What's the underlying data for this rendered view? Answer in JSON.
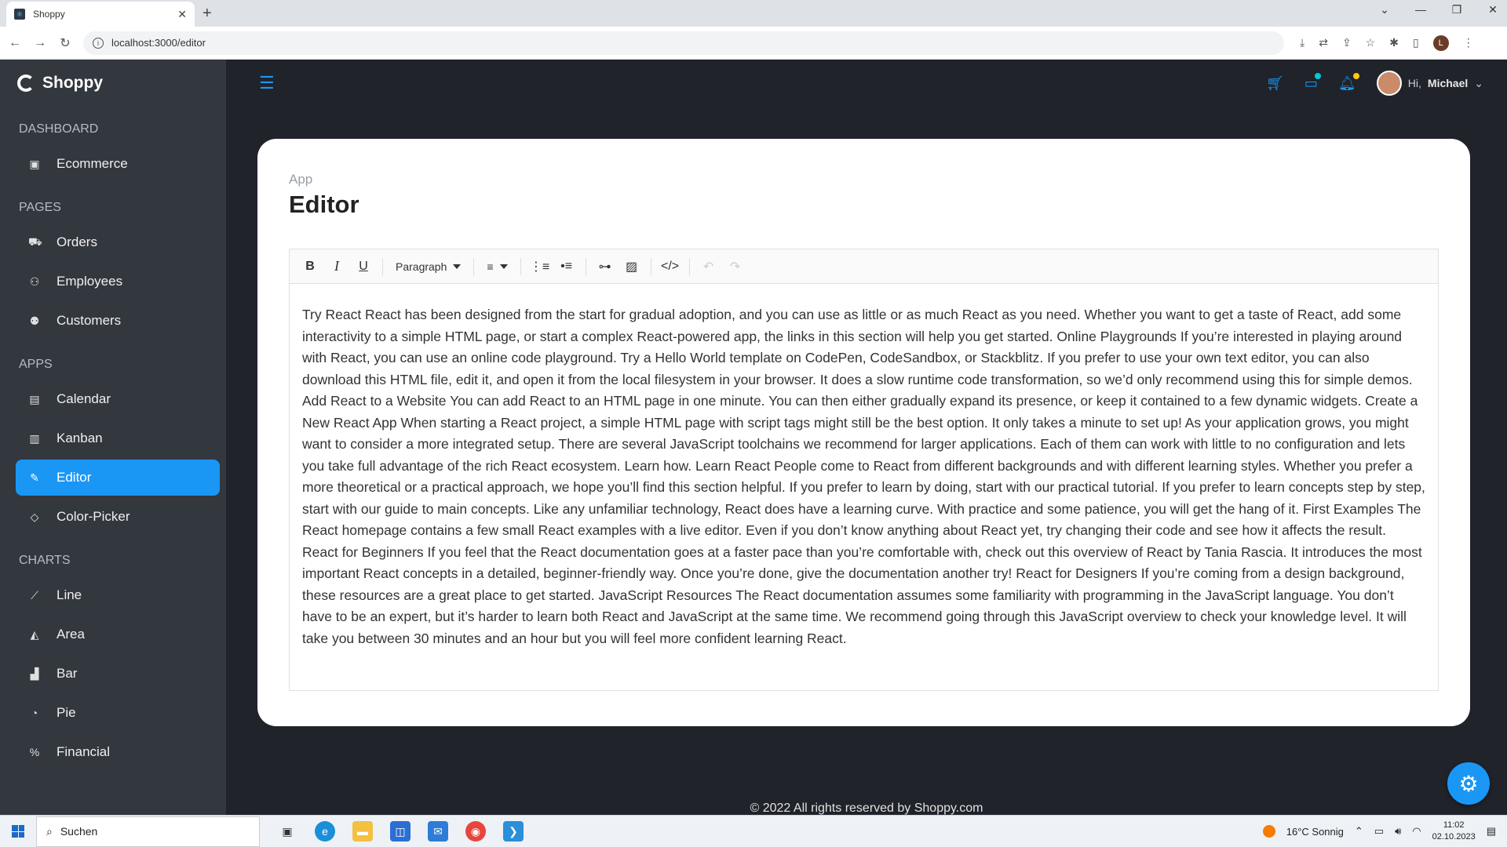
{
  "browser": {
    "tab_title": "Shoppy",
    "url": "localhost:3000/editor",
    "profile_initial": "L"
  },
  "brand": {
    "name": "Shoppy"
  },
  "sidebar": {
    "sections": [
      {
        "title": "DASHBOARD",
        "items": [
          {
            "label": "Ecommerce",
            "icon": "bag-icon"
          }
        ]
      },
      {
        "title": "PAGES",
        "items": [
          {
            "label": "Orders",
            "icon": "cart-icon"
          },
          {
            "label": "Employees",
            "icon": "people-icon"
          },
          {
            "label": "Customers",
            "icon": "customers-icon"
          }
        ]
      },
      {
        "title": "APPS",
        "items": [
          {
            "label": "Calendar",
            "icon": "calendar-icon"
          },
          {
            "label": "Kanban",
            "icon": "kanban-icon"
          },
          {
            "label": "Editor",
            "icon": "edit-icon",
            "active": true
          },
          {
            "label": "Color-Picker",
            "icon": "color-picker-icon"
          }
        ]
      },
      {
        "title": "CHARTS",
        "items": [
          {
            "label": "Line",
            "icon": "line-chart-icon"
          },
          {
            "label": "Area",
            "icon": "area-chart-icon"
          },
          {
            "label": "Bar",
            "icon": "bar-chart-icon"
          },
          {
            "label": "Pie",
            "icon": "pie-chart-icon"
          },
          {
            "label": "Financial",
            "icon": "financial-icon"
          }
        ]
      }
    ]
  },
  "topnav": {
    "greeting": "Hi,",
    "user_name": "Michael"
  },
  "page": {
    "breadcrumb": "App",
    "title": "Editor"
  },
  "editor": {
    "format_select": "Paragraph",
    "content": "Try React React has been designed from the start for gradual adoption, and you can use as little or as much React as you need. Whether you want to get a taste of React, add some interactivity to a simple HTML page, or start a complex React-powered app, the links in this section will help you get started. Online Playgrounds If you’re interested in playing around with React, you can use an online code playground. Try a Hello World template on CodePen, CodeSandbox, or Stackblitz. If you prefer to use your own text editor, you can also download this HTML file, edit it, and open it from the local filesystem in your browser. It does a slow runtime code transformation, so we’d only recommend using this for simple demos. Add React to a Website You can add React to an HTML page in one minute. You can then either gradually expand its presence, or keep it contained to a few dynamic widgets. Create a New React App When starting a React project, a simple HTML page with script tags might still be the best option. It only takes a minute to set up! As your application grows, you might want to consider a more integrated setup. There are several JavaScript toolchains we recommend for larger applications. Each of them can work with little to no configuration and lets you take full advantage of the rich React ecosystem. Learn how. Learn React People come to React from different backgrounds and with different learning styles. Whether you prefer a more theoretical or a practical approach, we hope you’ll find this section helpful. If you prefer to learn by doing, start with our practical tutorial. If you prefer to learn concepts step by step, start with our guide to main concepts. Like any unfamiliar technology, React does have a learning curve. With practice and some patience, you will get the hang of it. First Examples The React homepage contains a few small React examples with a live editor. Even if you don’t know anything about React yet, try changing their code and see how it affects the result. React for Beginners If you feel that the React documentation goes at a faster pace than you’re comfortable with, check out this overview of React by Tania Rascia. It introduces the most important React concepts in a detailed, beginner-friendly way. Once you’re done, give the documentation another try! React for Designers If you’re coming from a design background, these resources are a great place to get started. JavaScript Resources The React documentation assumes some familiarity with programming in the JavaScript language. You don’t have to be an expert, but it’s harder to learn both React and JavaScript at the same time. We recommend going through this JavaScript overview to check your knowledge level. It will take you between 30 minutes and an hour but you will feel more confident learning React."
  },
  "footer": {
    "text": "© 2022 All rights reserved by Shoppy.com"
  },
  "taskbar": {
    "search_placeholder": "Suchen",
    "weather": "16°C  Sonnig",
    "time": "11:02",
    "date": "02.10.2023"
  },
  "colors": {
    "accent": "#1a97f5",
    "sidebar_bg": "#33373e",
    "main_bg": "#20232a",
    "cart_dot": "#03c9d7",
    "bell_dot": "#fec90f"
  }
}
